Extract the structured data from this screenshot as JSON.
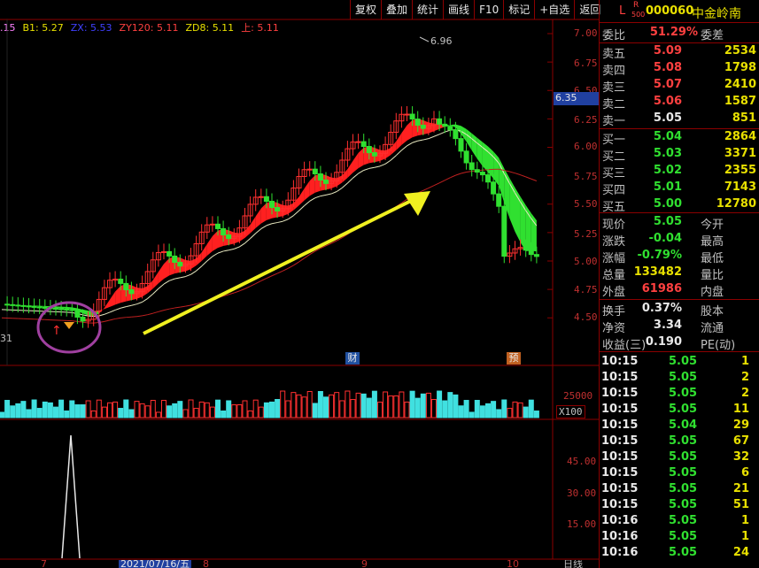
{
  "toolbar": [
    "复权",
    "叠加",
    "统计",
    "画线",
    "F10",
    "标记",
    "+自选",
    "返回"
  ],
  "indicators": [
    {
      "text": ".15",
      "color": "#ff80ff"
    },
    {
      "text": "B1: 5.27",
      "color": "#e8e000"
    },
    {
      "text": "ZX: 5.53",
      "color": "#4040ff"
    },
    {
      "text": "ZY120: 5.11",
      "color": "#ff4040"
    },
    {
      "text": "ZD8: 5.11",
      "color": "#e8e000"
    },
    {
      "text": "上: 5.11",
      "color": "#ff4040"
    }
  ],
  "price_axis": [
    "7.00",
    "6.75",
    "6.50",
    "6.25",
    "6.00",
    "5.75",
    "5.50",
    "5.25",
    "5.00",
    "4.75",
    "4.50"
  ],
  "price_marker": "6.35",
  "high_label": "6.96",
  "left_label": "31",
  "event_labels": {
    "cai": "财",
    "yu": "预"
  },
  "volume_axis": {
    "value": "25000",
    "unit": "X100"
  },
  "indicator_axis": [
    "45.00",
    "30.00",
    "15.00"
  ],
  "date_bar": {
    "d7": "7",
    "date": "2021/07/16/五",
    "d8": "8",
    "d9": "9",
    "d10": "10",
    "period": "日线"
  },
  "colors": {
    "up": "#ff3030",
    "down": "#30e030",
    "accent": "#e8e000",
    "grid": "#8b0000",
    "circle": "#a040a0",
    "arrow": "#f0f020"
  },
  "stock": {
    "L": "L",
    "R": "R",
    "R_sub": "500",
    "code": "000060",
    "name": "中金岭南"
  },
  "weibi": {
    "label": "委比",
    "value": "51.29%",
    "label2": "委差"
  },
  "asks": [
    {
      "label": "卖五",
      "price": "5.09",
      "vol": "2534"
    },
    {
      "label": "卖四",
      "price": "5.08",
      "vol": "1798"
    },
    {
      "label": "卖三",
      "price": "5.07",
      "vol": "2410"
    },
    {
      "label": "卖二",
      "price": "5.06",
      "vol": "1587"
    },
    {
      "label": "卖一",
      "price": "5.05",
      "vol": "851"
    }
  ],
  "bids": [
    {
      "label": "买一",
      "price": "5.04",
      "vol": "2864"
    },
    {
      "label": "买二",
      "price": "5.03",
      "vol": "3371"
    },
    {
      "label": "买三",
      "price": "5.02",
      "vol": "2355"
    },
    {
      "label": "买四",
      "price": "5.01",
      "vol": "7143"
    },
    {
      "label": "买五",
      "price": "5.00",
      "vol": "12780"
    }
  ],
  "quote": [
    {
      "l1": "现价",
      "v": "5.05",
      "l2": "今开"
    },
    {
      "l1": "涨跌",
      "v": "-0.04",
      "l2": "最高"
    },
    {
      "l1": "涨幅",
      "v": "-0.79%",
      "l2": "最低"
    },
    {
      "l1": "总量",
      "v": "133482",
      "l2": "量比"
    },
    {
      "l1": "外盘",
      "v": "61986",
      "l2": "内盘"
    }
  ],
  "finance": [
    {
      "l1": "换手",
      "v": "0.37%",
      "l2": "股本"
    },
    {
      "l1": "净资",
      "v": "3.34",
      "l2": "流通"
    },
    {
      "l1": "收益(三)",
      "v": "0.190",
      "l2": "PE(动)"
    }
  ],
  "ticks": [
    {
      "t": "10:15",
      "p": "5.05",
      "q": "1"
    },
    {
      "t": "10:15",
      "p": "5.05",
      "q": "2"
    },
    {
      "t": "10:15",
      "p": "5.05",
      "q": "2"
    },
    {
      "t": "10:15",
      "p": "5.05",
      "q": "11"
    },
    {
      "t": "10:15",
      "p": "5.04",
      "q": "29"
    },
    {
      "t": "10:15",
      "p": "5.05",
      "q": "67"
    },
    {
      "t": "10:15",
      "p": "5.05",
      "q": "32"
    },
    {
      "t": "10:15",
      "p": "5.05",
      "q": "6"
    },
    {
      "t": "10:15",
      "p": "5.05",
      "q": "21"
    },
    {
      "t": "10:15",
      "p": "5.05",
      "q": "51"
    },
    {
      "t": "10:16",
      "p": "5.05",
      "q": "1"
    },
    {
      "t": "10:16",
      "p": "5.05",
      "q": "1"
    },
    {
      "t": "10:16",
      "p": "5.05",
      "q": "24"
    }
  ]
}
